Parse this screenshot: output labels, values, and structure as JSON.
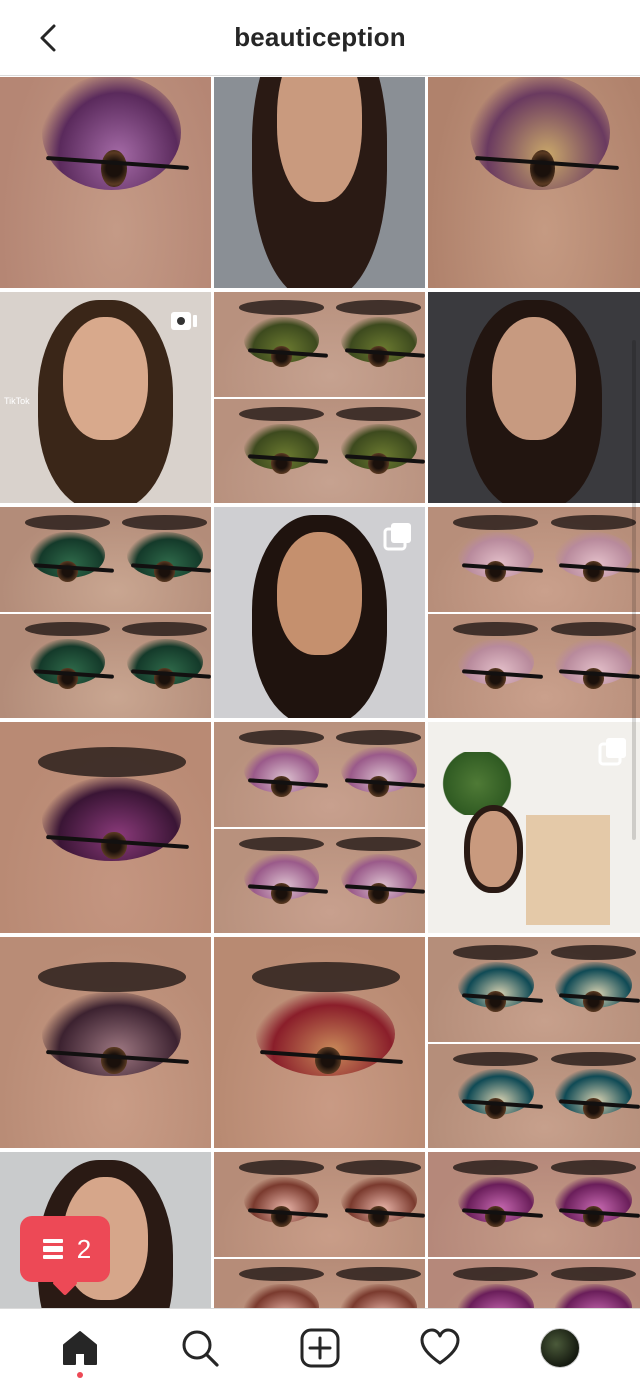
{
  "header": {
    "title": "beautiception",
    "back_icon": "chevron-left-icon"
  },
  "posts": [
    {
      "type": "eye",
      "palette": "plum-sparkle"
    },
    {
      "type": "portrait",
      "palette": "neutral"
    },
    {
      "type": "eye",
      "palette": "gold-plum"
    },
    {
      "type": "portrait",
      "palette": "tiktok-concealer",
      "badge": "reel-icon",
      "overlay_text": "TikTok"
    },
    {
      "type": "split",
      "palette": "olive-green"
    },
    {
      "type": "portrait",
      "palette": "dark-top"
    },
    {
      "type": "split",
      "palette": "emerald"
    },
    {
      "type": "portrait",
      "palette": "curly",
      "badge": "carousel-icon"
    },
    {
      "type": "split",
      "palette": "pink-glitter"
    },
    {
      "type": "eye",
      "palette": "purple-smoke"
    },
    {
      "type": "split",
      "palette": "lilac"
    },
    {
      "type": "room",
      "palette": "room",
      "badge": "carousel-icon"
    },
    {
      "type": "eye",
      "palette": "taupe-wing"
    },
    {
      "type": "eye",
      "palette": "red-copper"
    },
    {
      "type": "split",
      "palette": "teal"
    },
    {
      "type": "portrait",
      "palette": "red-lip"
    },
    {
      "type": "split",
      "palette": "peach-pink"
    },
    {
      "type": "split",
      "palette": "magenta"
    }
  ],
  "notification": {
    "icon": "activity-icon",
    "count": "2",
    "color": "#ed4956"
  },
  "nav": {
    "home_icon": "home-icon",
    "search_icon": "search-icon",
    "new_post_icon": "new-post-icon",
    "activity_icon": "heart-icon",
    "profile_icon": "profile-avatar"
  },
  "colors": {
    "text": "#262626",
    "divider": "#dbdbdb",
    "accent": "#ed4956"
  }
}
